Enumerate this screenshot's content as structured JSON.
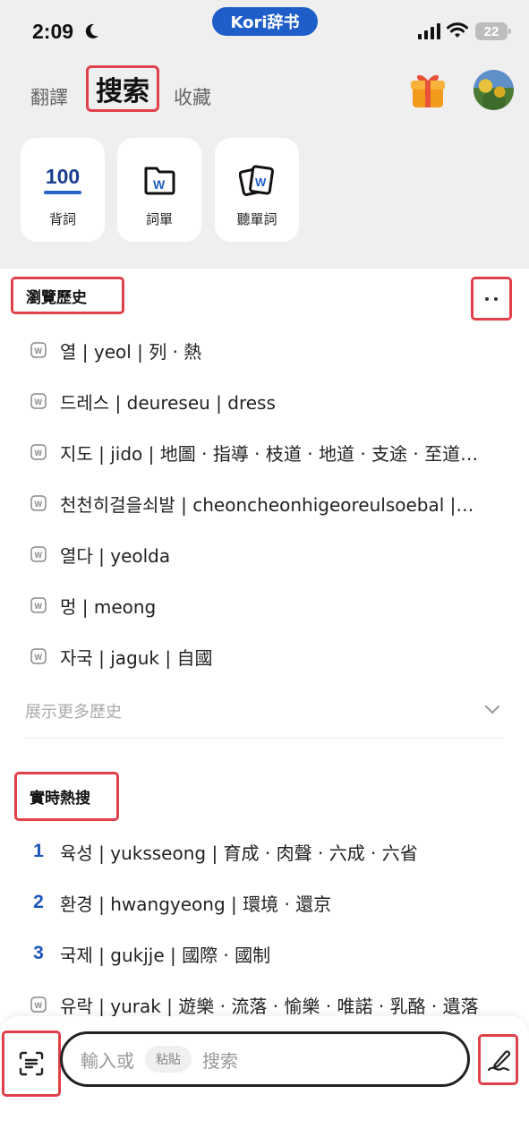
{
  "status_bar": {
    "time": "2:09",
    "battery": "22",
    "moon_icon": "moon-icon",
    "signal_icon": "signal-bars-icon",
    "wifi_icon": "wifi-icon"
  },
  "app_pill": {
    "label": "Kori辞书"
  },
  "header": {
    "tabs": [
      {
        "label": "翻譯"
      },
      {
        "label": "搜索",
        "active": true
      },
      {
        "label": "收藏"
      }
    ],
    "gift_icon": "gift-icon",
    "avatar": "avatar"
  },
  "features": [
    {
      "label": "背詞",
      "icon_text": "100"
    },
    {
      "label": "詞單",
      "icon": "wordbook-icon"
    },
    {
      "label": "聽單詞",
      "icon": "stacked-cards-icon"
    }
  ],
  "history": {
    "title": "瀏覽歷史",
    "more_icon": "more-icon",
    "items": [
      {
        "text": "열 | yeol | 列 · 熱"
      },
      {
        "text": "드레스 | deureseu | dress"
      },
      {
        "text": "지도 | jido | 地圖 · 指導 · 枝道 · 地道 · 支途 · 至道…"
      },
      {
        "text": "천천히걸을쇠발 | cheoncheonhigeoreulsoebal |…"
      },
      {
        "text": "열다 | yeolda"
      },
      {
        "text": "멍 | meong"
      },
      {
        "text": "자국 | jaguk | 自國"
      }
    ],
    "show_more": "展示更多歷史"
  },
  "trending": {
    "title": "實時熱搜",
    "items": [
      {
        "rank": "1",
        "text": "육성 | yuksseong | 育成 · 肉聲 · 六成 · 六省"
      },
      {
        "rank": "2",
        "text": "환경 | hwangyeong | 環境 · 還京"
      },
      {
        "rank": "3",
        "text": "국제 | gukjje | 國際 · 國制"
      },
      {
        "rank": "",
        "text": "유락 | yurak | 遊樂 · 流落 · 愉樂 · 唯諾 · 乳酪 · 遺落"
      }
    ]
  },
  "search_bar": {
    "prefix": "輸入或",
    "paste_chip": "粘貼",
    "suffix": "搜索",
    "scan_icon": "scan-text-icon",
    "handwriting_icon": "handwriting-icon"
  },
  "colors": {
    "accent_blue": "#1f5ec9",
    "highlight_red": "#e0404a",
    "header_bg": "#efefef"
  }
}
